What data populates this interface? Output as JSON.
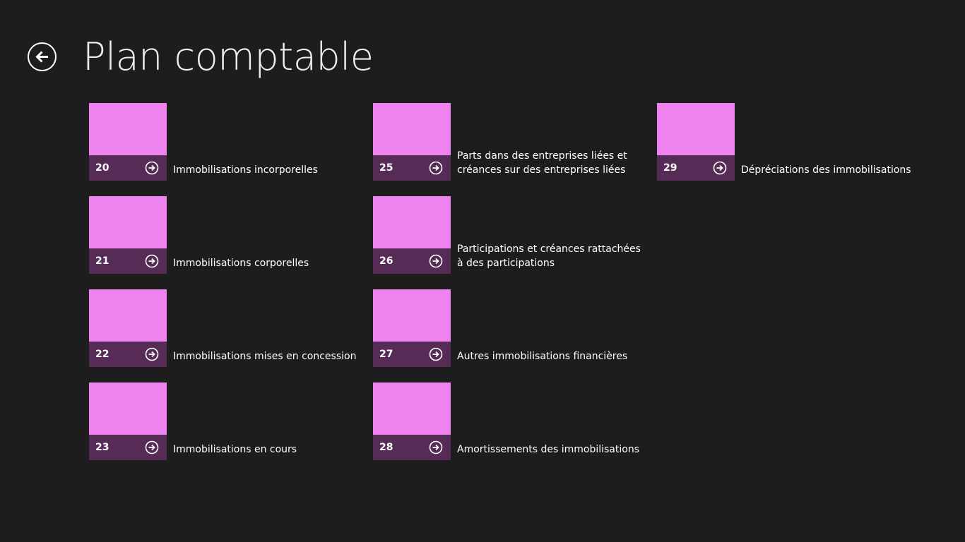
{
  "header": {
    "title": "Plan comptable",
    "back_icon": "back-arrow-circle-icon"
  },
  "colors": {
    "background": "#1d1d1d",
    "tile": "#ee82ee",
    "tile_bar": "#562c56",
    "text": "#ffffff"
  },
  "items": [
    {
      "number": "20",
      "label": "Immobilisations incorporelles"
    },
    {
      "number": "21",
      "label": "Immobilisations corporelles"
    },
    {
      "number": "22",
      "label": "Immobilisations mises en concession"
    },
    {
      "number": "23",
      "label": "Immobilisations en cours"
    },
    {
      "number": "25",
      "label": "Parts dans des entreprises liées et créances sur des entreprises liées"
    },
    {
      "number": "26",
      "label": "Participations et créances rattachées à des participations"
    },
    {
      "number": "27",
      "label": "Autres immobilisations financières"
    },
    {
      "number": "28",
      "label": "Amortissements des immobilisations"
    },
    {
      "number": "29",
      "label": "Dépréciations des immobilisations"
    }
  ]
}
